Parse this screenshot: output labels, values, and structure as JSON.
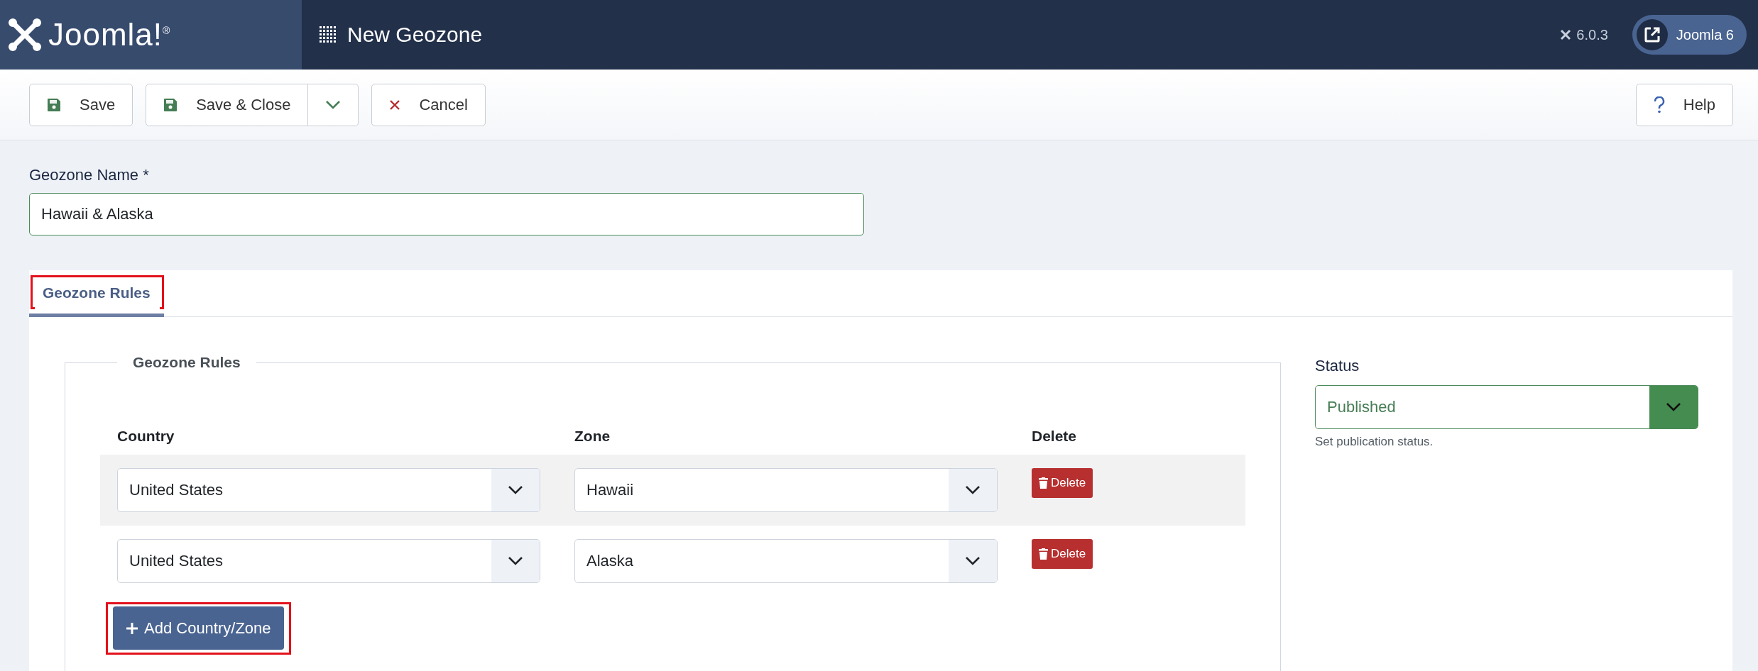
{
  "header": {
    "logo": "Joomla!$^{®}$",
    "title": "New Geozone",
    "version": "6.0.3",
    "site_button": "Joomla 6"
  },
  "toolbar": {
    "buttons": [
      {
        "label": "Save",
        "kind": "save"
      },
      {
        "label": "Save & Close",
        "kind": "split"
      },
      {
        "label": "Cancel",
        "kind": "cancel"
      }
    ],
    "help": "Help"
  },
  "name_field": {
    "label": "Geozone Name *",
    "value": "Hawaii & Alaska"
  },
  "tabs": [
    {
      "label": "Geozone Rules",
      "selected": true,
      "highlighted": true
    }
  ],
  "rules": {
    "legend": "Geozone Rules",
    "columns": [
      "Country",
      "Zone",
      "Delete"
    ],
    "rows": [
      {
        "country": "United States",
        "zone": "Hawaii",
        "delete": "Delete"
      },
      {
        "country": "United States",
        "zone": "Alaska",
        "delete": "Delete"
      }
    ],
    "add_button": {
      "label": "Add Country/Zone",
      "highlighted": true
    }
  },
  "status": {
    "label": "Status",
    "value": "Published",
    "help": "Set publication status."
  }
}
